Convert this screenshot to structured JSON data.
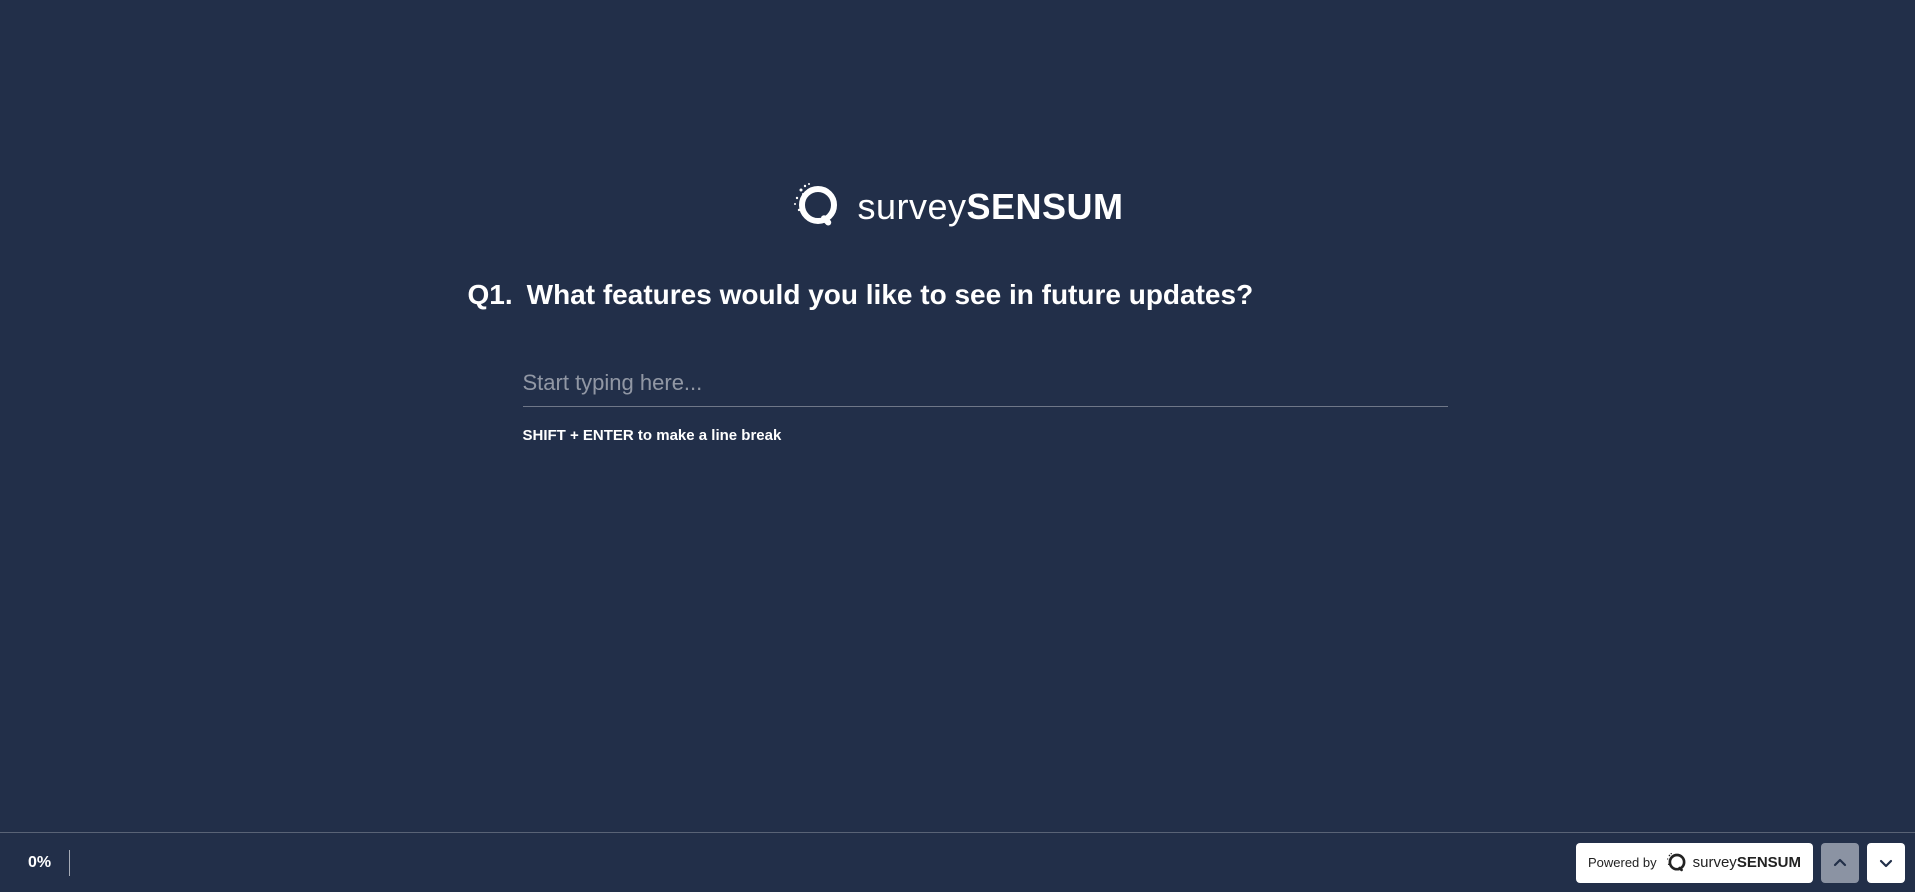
{
  "brand": {
    "name_light": "survey",
    "name_bold": "SENSUM"
  },
  "question": {
    "number": "Q1.",
    "text": "What features would you like to see in future updates?",
    "placeholder": "Start typing here...",
    "hint": "SHIFT + ENTER to make a line break"
  },
  "footer": {
    "progress": "0%",
    "powered_by": "Powered by",
    "powered_brand_light": "survey",
    "powered_brand_bold": "SENSUM"
  }
}
